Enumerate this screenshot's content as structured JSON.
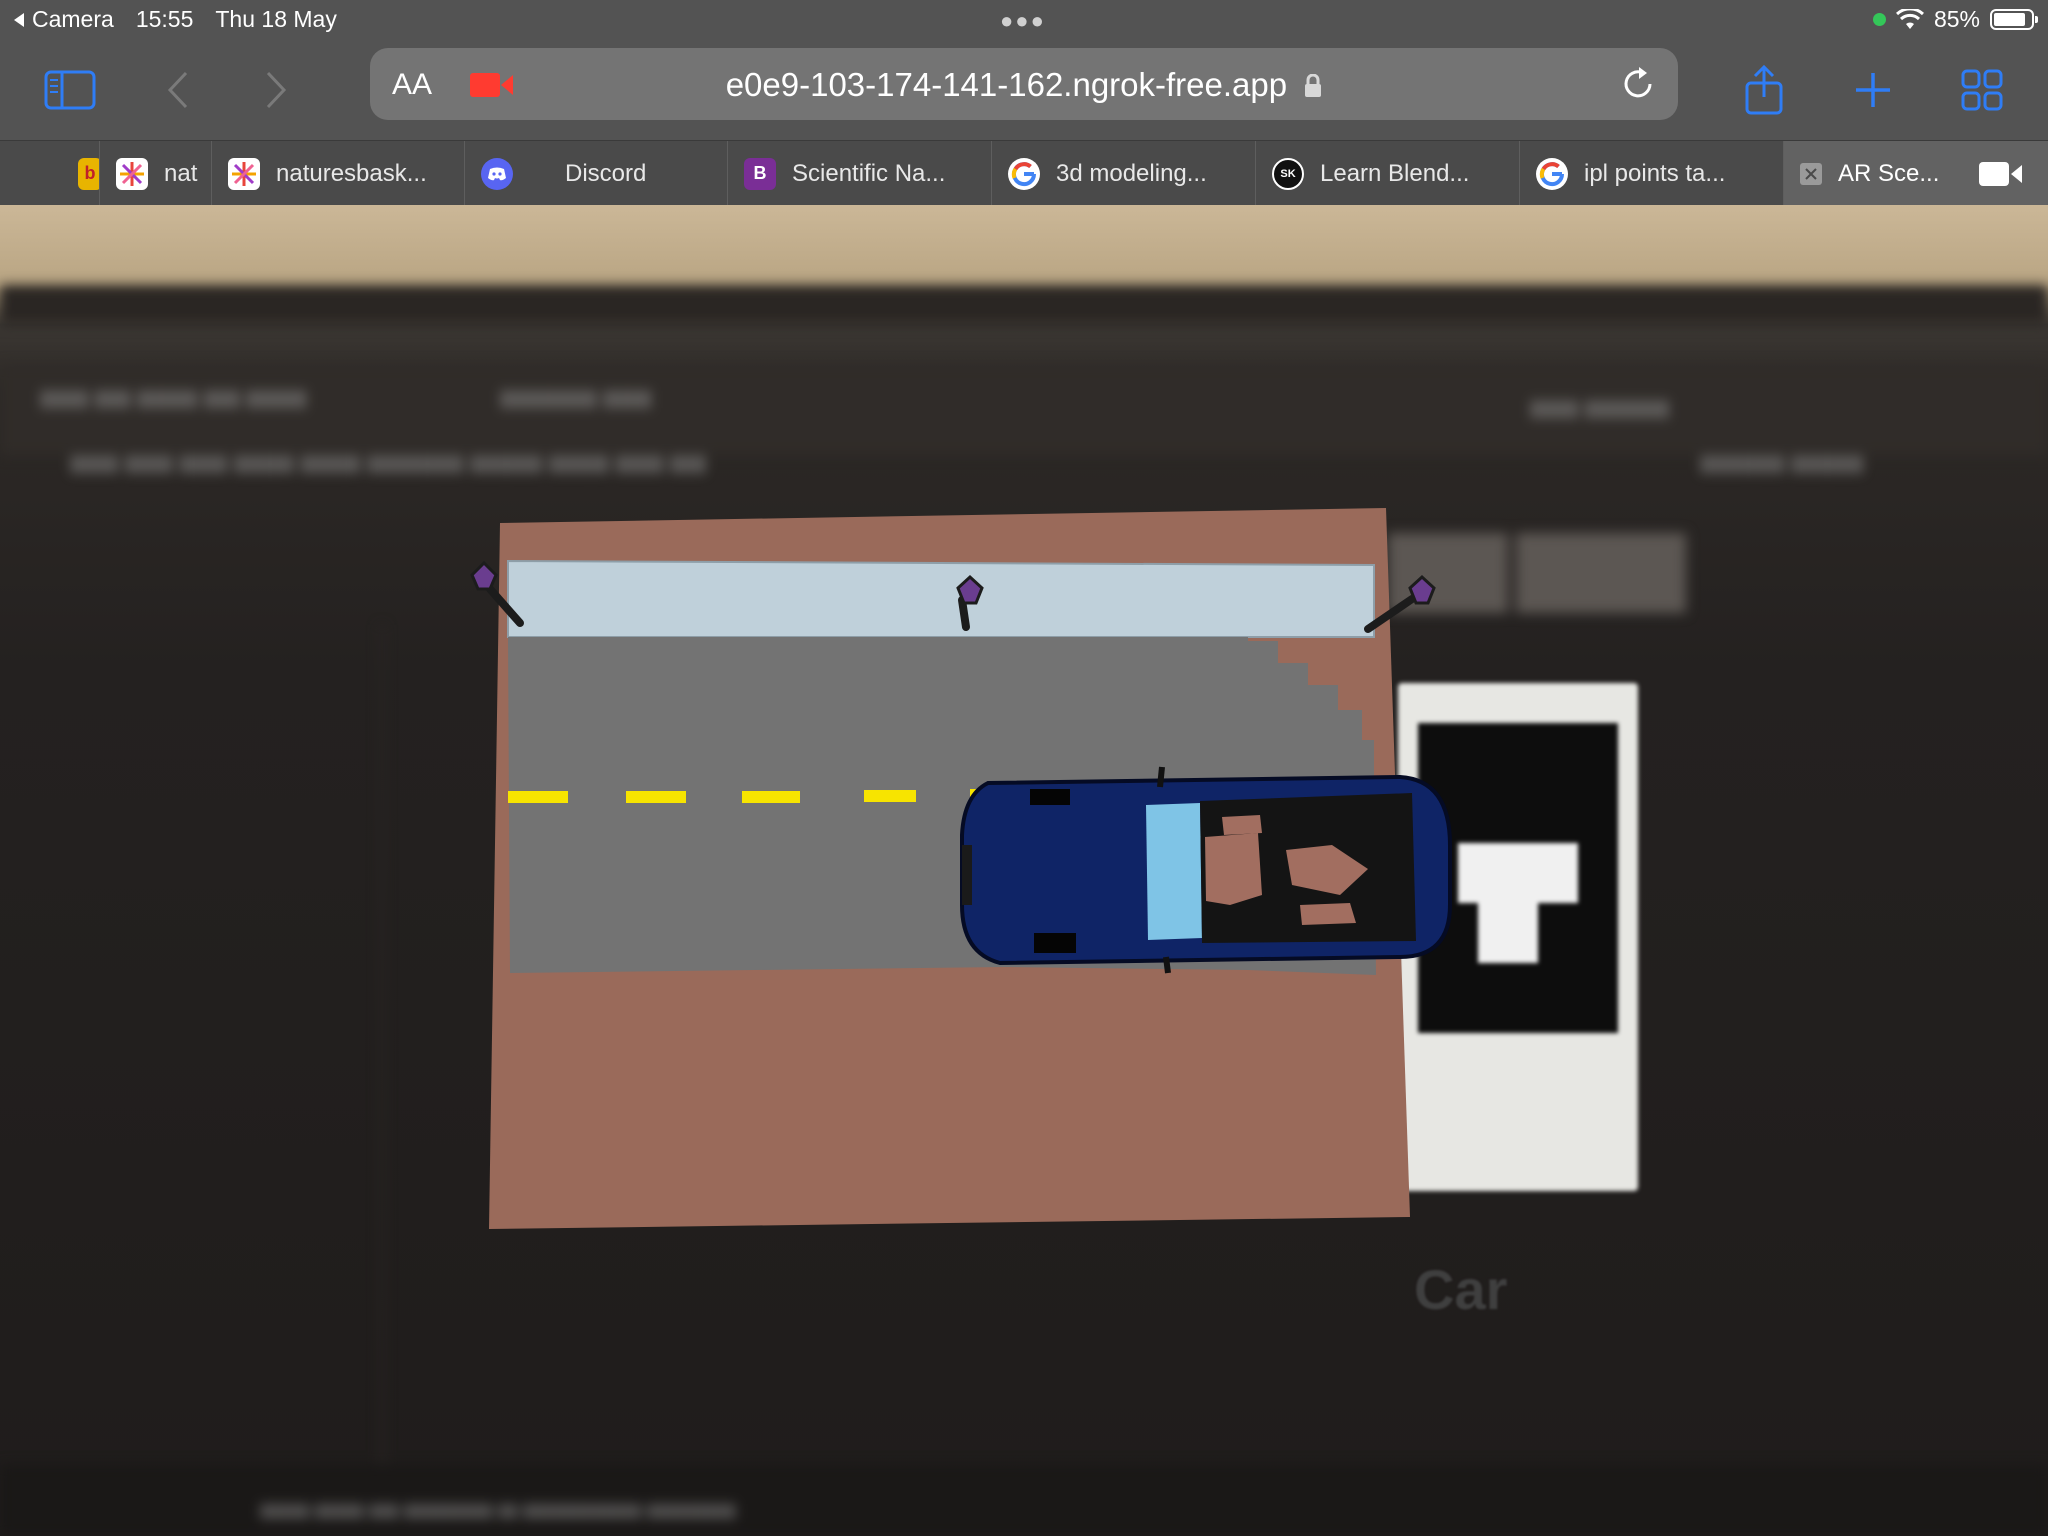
{
  "status": {
    "back_app": "Camera",
    "time": "15:55",
    "date": "Thu 18 May",
    "battery": "85%",
    "battery_level": 0.85
  },
  "address_bar": {
    "text_size_label": "AA",
    "url": "e0e9-103-174-141-162.ngrok-free.app"
  },
  "tabs": [
    {
      "label": "nat",
      "icon": "sparkle-favicon",
      "color": "#ffffff"
    },
    {
      "label": "naturesbask...",
      "icon": "sparkle-favicon",
      "color": "#ffffff"
    },
    {
      "label": "Discord",
      "icon": "discord-favicon",
      "color": "#5865f2"
    },
    {
      "label": "Scientific Na...",
      "icon": "bootstrap-favicon",
      "color": "#7a2e96"
    },
    {
      "label": "3d modeling...",
      "icon": "google-favicon",
      "color": "#ffffff"
    },
    {
      "label": "Learn Blend...",
      "icon": "sk-favicon",
      "color": "#111111"
    },
    {
      "label": "ipl points ta...",
      "icon": "google-favicon",
      "color": "#ffffff"
    },
    {
      "label": "AR Sce...",
      "icon": "close-icon",
      "color": "#9a9a9a"
    }
  ],
  "scene": {
    "marker_label": "Car"
  },
  "colors": {
    "chrome": "#535353",
    "accent": "#2f7df6",
    "ground": "#9a6a5a",
    "sidewalk": "#bfd0da",
    "road": "#737373",
    "lane_marking": "#f7e400",
    "car_body": "#0f2466"
  }
}
